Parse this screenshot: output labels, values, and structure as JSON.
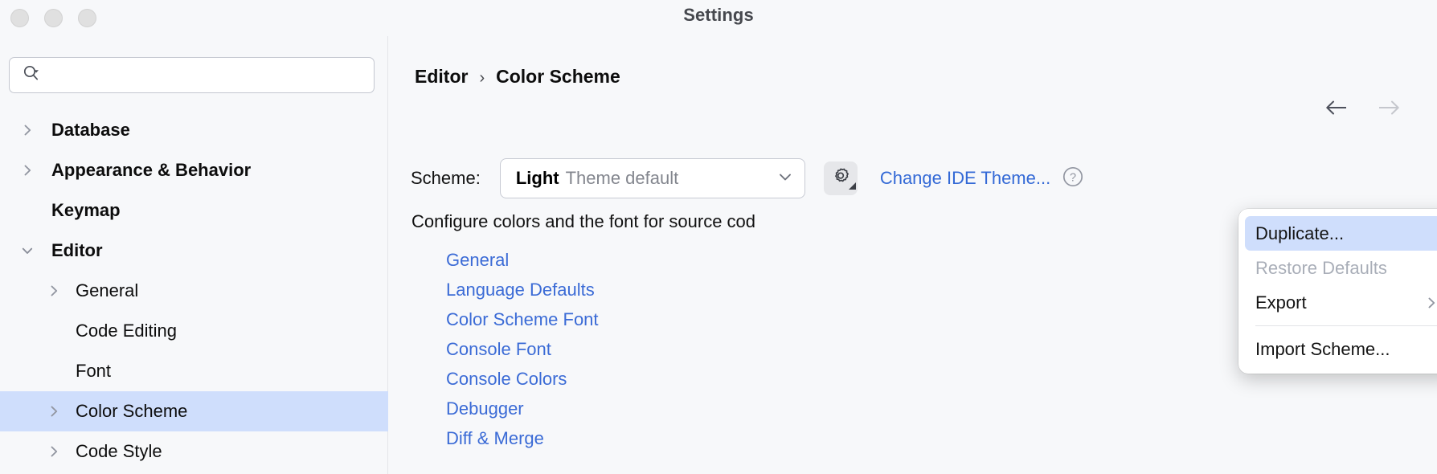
{
  "window": {
    "title": "Settings",
    "traffic_lights": [
      "close-button",
      "minimize-button",
      "zoom-button"
    ]
  },
  "sidebar": {
    "search": {
      "value": "",
      "placeholder": "",
      "icon": "search-icon"
    },
    "items": [
      {
        "label": "Database",
        "depth": 0,
        "arrow": "chevron-right",
        "selected": false
      },
      {
        "label": "Appearance & Behavior",
        "depth": 0,
        "arrow": "chevron-right",
        "selected": false
      },
      {
        "label": "Keymap",
        "depth": 0,
        "arrow": "none",
        "selected": false
      },
      {
        "label": "Editor",
        "depth": 0,
        "arrow": "chevron-down",
        "selected": false
      },
      {
        "label": "General",
        "depth": 1,
        "arrow": "chevron-right",
        "selected": false
      },
      {
        "label": "Code Editing",
        "depth": 1,
        "arrow": "none",
        "selected": false
      },
      {
        "label": "Font",
        "depth": 1,
        "arrow": "none",
        "selected": false
      },
      {
        "label": "Color Scheme",
        "depth": 1,
        "arrow": "chevron-right",
        "selected": true
      },
      {
        "label": "Code Style",
        "depth": 1,
        "arrow": "chevron-right",
        "selected": false
      }
    ]
  },
  "main": {
    "breadcrumb": {
      "parent": "Editor",
      "separator": "›",
      "current": "Color Scheme"
    },
    "nav": {
      "back_icon": "arrow-left-icon",
      "forward_icon": "arrow-right-icon",
      "back_enabled": true,
      "forward_enabled": false
    },
    "scheme": {
      "label": "Scheme:",
      "value_name": "Light",
      "value_suffix": "Theme default",
      "chevron": "chevron-down-icon",
      "gear_icon": "gear-icon",
      "change_theme_label": "Change IDE Theme...",
      "help_icon": "help-circle-icon"
    },
    "description": "Configure colors and the font for source cod",
    "links": [
      "General",
      "Language Defaults",
      "Color Scheme Font",
      "Console Font",
      "Console Colors",
      "Debugger",
      "Diff & Merge"
    ]
  },
  "gear_menu": {
    "items": [
      {
        "label": "Duplicate...",
        "state": "highlighted",
        "submenu": false
      },
      {
        "label": "Restore Defaults",
        "state": "disabled",
        "submenu": false
      },
      {
        "label": "Export",
        "state": "normal",
        "submenu": true
      },
      {
        "label": "Import Scheme...",
        "state": "normal",
        "submenu": false
      }
    ],
    "separator_after_index": 2
  },
  "colors": {
    "background": "#f7f8fa",
    "selection": "#cfdefc",
    "link": "#3b6bd6",
    "text": "#0d0d0d",
    "muted": "#83868e",
    "border": "#c7cad3"
  }
}
